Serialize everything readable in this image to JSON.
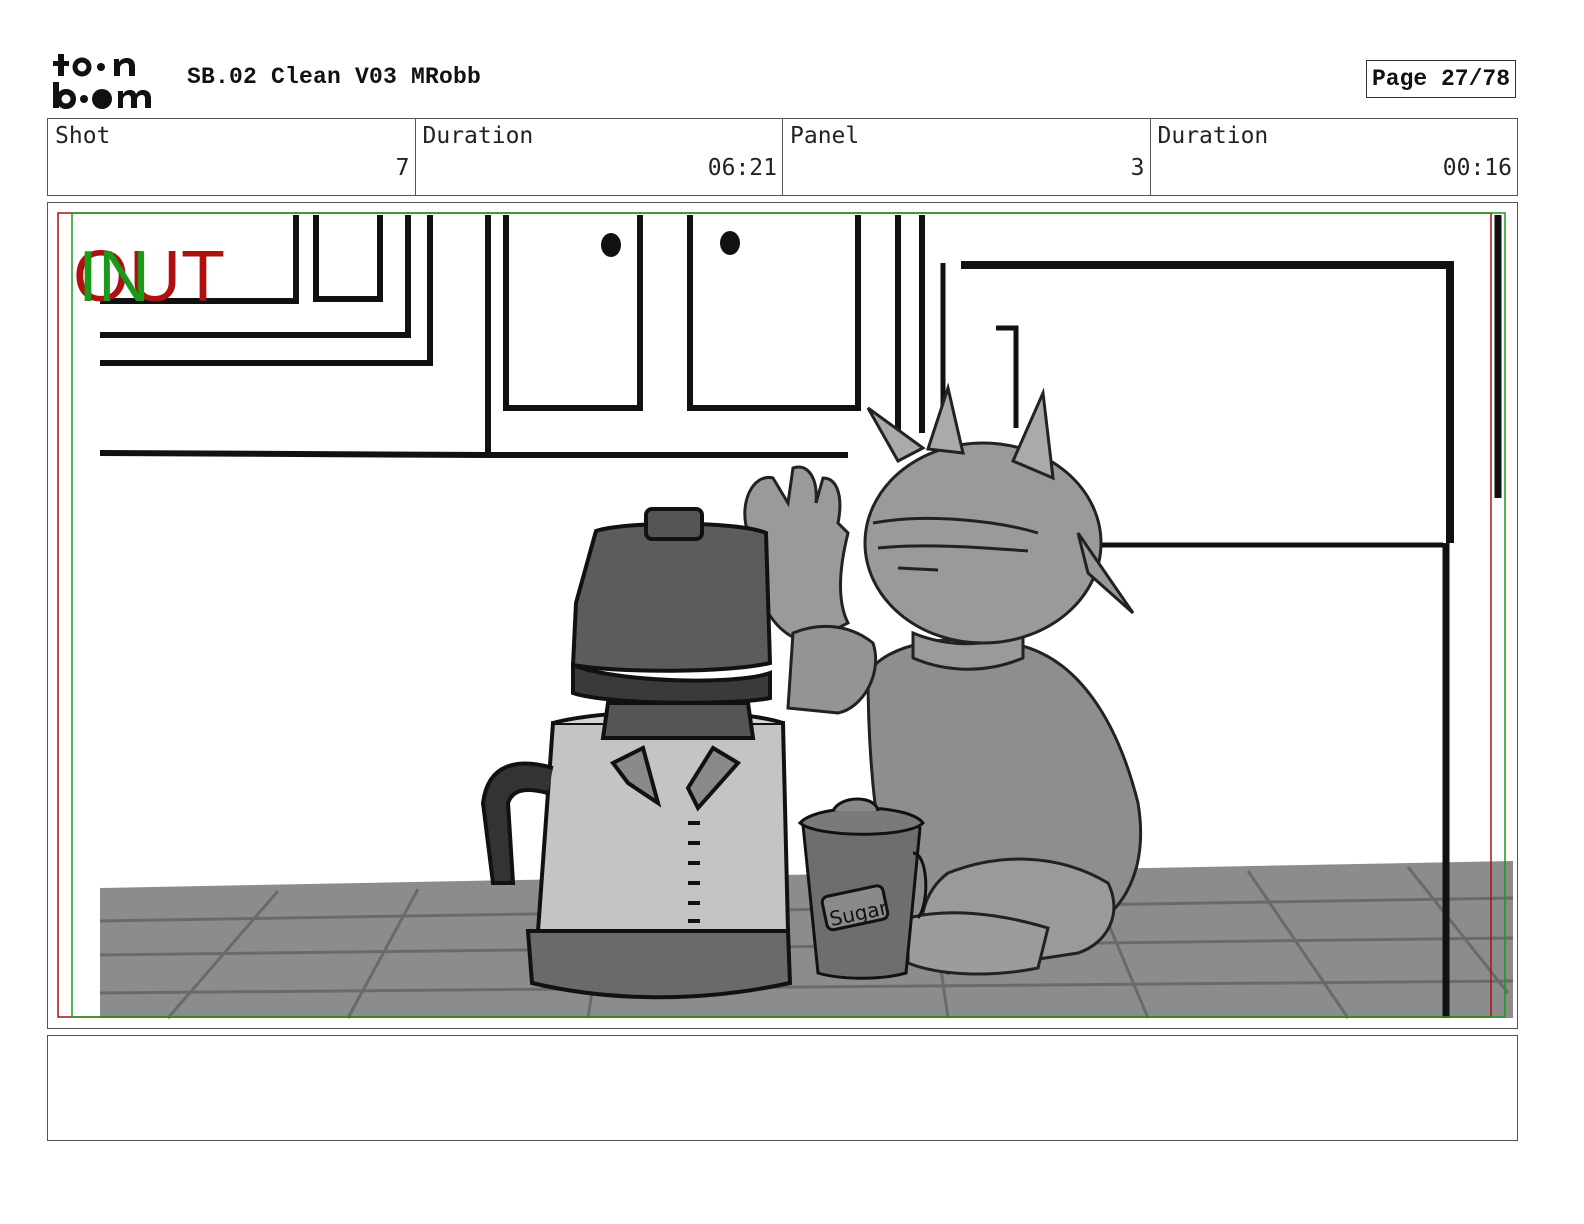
{
  "header": {
    "logo_text_top": "toon",
    "logo_text_bottom": "boom",
    "document_title": "SB.02 Clean V03 MRobb",
    "page_label": "Page 27/78"
  },
  "info": {
    "shot_label": "Shot",
    "shot_value": "7",
    "shot_duration_label": "Duration",
    "shot_duration_value": "06:21",
    "panel_label": "Panel",
    "panel_value": "3",
    "panel_duration_label": "Duration",
    "panel_duration_value": "00:16"
  },
  "panel_markers": {
    "in_label": "IN",
    "out_label": "OUT",
    "in_color": "#1a9a1a",
    "out_color": "#b01010"
  },
  "drawing": {
    "sugar_label": "Sugar"
  },
  "notes": {
    "text": ""
  }
}
